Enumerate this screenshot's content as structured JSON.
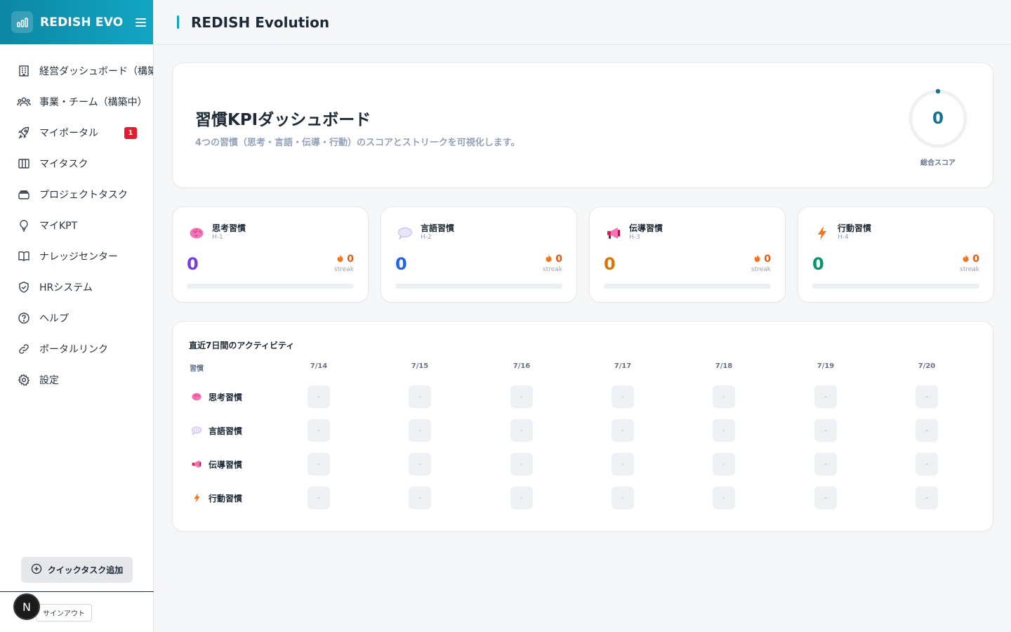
{
  "app": {
    "brand": "REDISH EVO",
    "header_title": "REDISH Evolution"
  },
  "sidebar": {
    "items": [
      {
        "label": "経営ダッシュボード（構築中）",
        "icon": "building-icon"
      },
      {
        "label": "事業・チーム（構築中）",
        "icon": "users-icon"
      },
      {
        "label": "マイポータル",
        "icon": "rocket-icon",
        "badge": "1"
      },
      {
        "label": "マイタスク",
        "icon": "columns-icon"
      },
      {
        "label": "プロジェクトタスク",
        "icon": "layers-icon"
      },
      {
        "label": "マイKPT",
        "icon": "lightbulb-icon"
      },
      {
        "label": "ナレッジセンター",
        "icon": "book-icon"
      },
      {
        "label": "HRシステム",
        "icon": "shield-icon"
      },
      {
        "label": "ヘルプ",
        "icon": "help-circle-icon"
      },
      {
        "label": "ポータルリンク",
        "icon": "link-icon"
      },
      {
        "label": "設定",
        "icon": "gear-icon"
      }
    ],
    "quick_add_label": "クイックタスク追加",
    "avatar_initial": "N",
    "signout_label": "サインアウト"
  },
  "hero": {
    "title": "習慣KPIダッシュボード",
    "subtitle": "4つの習慣（思考・言語・伝導・行動）のスコアとストリークを可視化します。",
    "total_score": "0",
    "total_score_label": "総合スコア"
  },
  "habits": [
    {
      "name": "思考習慣",
      "code": "H-1",
      "score": "0",
      "streak": "0",
      "streak_label": "streak",
      "color": "#7c3aed",
      "icon": "brain-icon"
    },
    {
      "name": "言語習慣",
      "code": "H-2",
      "score": "0",
      "streak": "0",
      "streak_label": "streak",
      "color": "#2563eb",
      "icon": "speech-bubble-icon"
    },
    {
      "name": "伝導習慣",
      "code": "H-3",
      "score": "0",
      "streak": "0",
      "streak_label": "streak",
      "color": "#d97706",
      "icon": "megaphone-icon"
    },
    {
      "name": "行動習慣",
      "code": "H-4",
      "score": "0",
      "streak": "0",
      "streak_label": "streak",
      "color": "#059669",
      "icon": "lightning-icon"
    }
  ],
  "activity": {
    "title": "直近7日間のアクティビティ",
    "habit_header": "習慣",
    "dates": [
      "7/14",
      "7/15",
      "7/16",
      "7/17",
      "7/18",
      "7/19",
      "7/20"
    ],
    "rows": [
      {
        "name": "思考習慣",
        "icon": "brain-icon",
        "cells": [
          "-",
          "-",
          "-",
          "-",
          "-",
          "-",
          "-"
        ]
      },
      {
        "name": "言語習慣",
        "icon": "speech-bubble-icon",
        "cells": [
          "-",
          "-",
          "-",
          "-",
          "-",
          "-",
          "-"
        ]
      },
      {
        "name": "伝導習慣",
        "icon": "megaphone-icon",
        "cells": [
          "-",
          "-",
          "-",
          "-",
          "-",
          "-",
          "-"
        ]
      },
      {
        "name": "行動習慣",
        "icon": "lightning-icon",
        "cells": [
          "-",
          "-",
          "-",
          "-",
          "-",
          "-",
          "-"
        ]
      }
    ]
  },
  "colors": {
    "brand": "#0c87a3",
    "accent": "#0ea5c4",
    "streak": "#ea580c",
    "badge": "#e11d2e"
  }
}
